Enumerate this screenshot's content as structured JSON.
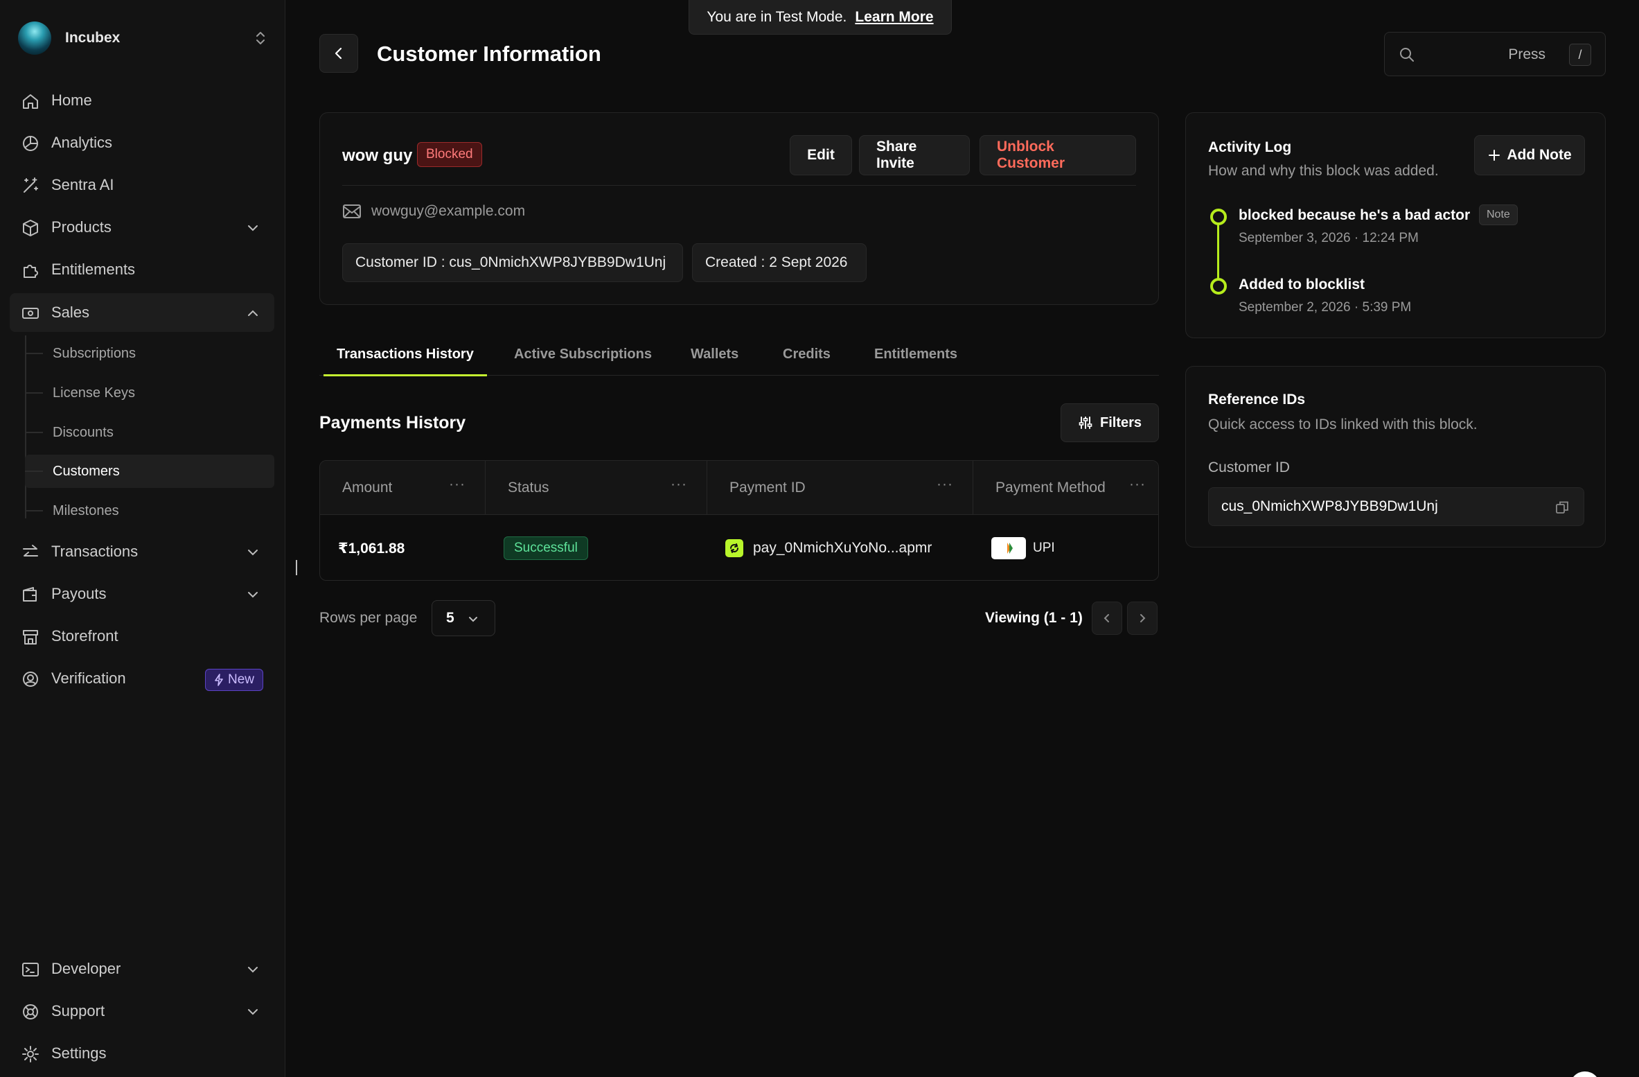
{
  "sidebar": {
    "org_name": "Incubex",
    "items": [
      {
        "label": "Home",
        "icon": "home-icon"
      },
      {
        "label": "Analytics",
        "icon": "analytics-icon"
      },
      {
        "label": "Sentra AI",
        "icon": "sparkle-wand-icon"
      },
      {
        "label": "Products",
        "icon": "box-icon"
      },
      {
        "label": "Entitlements",
        "icon": "puzzle-icon"
      },
      {
        "label": "Sales",
        "icon": "cash-icon"
      },
      {
        "label": "Transactions",
        "icon": "arrows-swap-icon"
      },
      {
        "label": "Payouts",
        "icon": "wallet-icon"
      },
      {
        "label": "Storefront",
        "icon": "store-icon"
      },
      {
        "label": "Verification",
        "icon": "user-check-icon",
        "badge": "New"
      }
    ],
    "sales_subitems": [
      "Subscriptions",
      "License Keys",
      "Discounts",
      "Customers",
      "Milestones"
    ],
    "active_subitem": "Customers",
    "bottom_items": [
      {
        "label": "Developer",
        "icon": "terminal-icon"
      },
      {
        "label": "Support",
        "icon": "lifebuoy-icon"
      },
      {
        "label": "Settings",
        "icon": "gear-icon"
      }
    ]
  },
  "banner": {
    "text": "You are in Test Mode.",
    "link": "Learn More"
  },
  "header": {
    "title": "Customer Information",
    "search_hint": "Press",
    "search_key": "/"
  },
  "customer": {
    "name": "wow guy",
    "status": "Blocked",
    "email": "wowguy@example.com",
    "customer_id_chip": "Customer ID : cus_0NmichXWP8JYBB9Dw1Unj",
    "created_chip": "Created : 2 Sept 2026",
    "buttons": {
      "edit": "Edit",
      "share": "Share Invite",
      "unblock": "Unblock Customer"
    }
  },
  "tabs": [
    "Transactions History",
    "Active Subscriptions",
    "Wallets",
    "Credits",
    "Entitlements"
  ],
  "active_tab": "Transactions History",
  "payments": {
    "title": "Payments History",
    "filters_label": "Filters",
    "columns": [
      "Amount",
      "Status",
      "Payment ID",
      "Payment Method"
    ],
    "rows": [
      {
        "amount": "₹1,061.88",
        "status": "Successful",
        "payment_id": "pay_0NmichXuYoNo...apmr",
        "method": "UPI"
      }
    ],
    "rows_per_page_label": "Rows per page",
    "rows_per_page": "5",
    "viewing": "Viewing (1 - 1)"
  },
  "activity": {
    "title": "Activity Log",
    "subtitle": "How and why this block was added.",
    "add_note": "Add Note",
    "entries": [
      {
        "title": "blocked because he's a bad actor",
        "tag": "Note",
        "date": "September 3, 2026 · 12:24 PM"
      },
      {
        "title": "Added to blocklist",
        "date": "September 2, 2026 · 5:39 PM"
      }
    ]
  },
  "reference": {
    "title": "Reference IDs",
    "subtitle": "Quick access to IDs linked with this block.",
    "field_label": "Customer ID",
    "field_value": "cus_0NmichXWP8JYBB9Dw1Unj"
  },
  "colors": {
    "accent": "#c4f230",
    "danger": "#ff6b5b",
    "background": "#0d0d0d",
    "new_badge": "#2b1f63"
  }
}
